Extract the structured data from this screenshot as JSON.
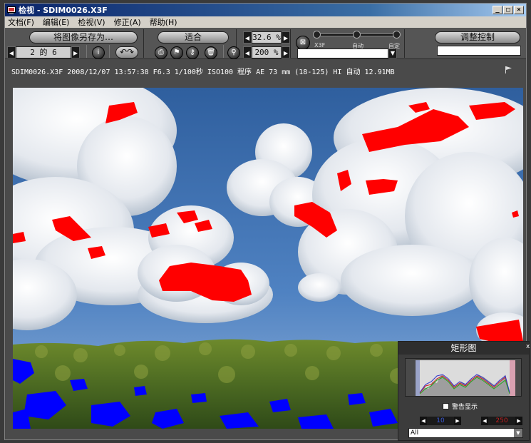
{
  "window": {
    "title": "检视 - SDIM0026.X3F",
    "btn_min": "_",
    "btn_max": "□",
    "btn_close": "×"
  },
  "menu": {
    "items": [
      "文档(F)",
      "编辑(E)",
      "检视(V)",
      "修正(A)",
      "帮助(H)"
    ]
  },
  "toolbar": {
    "save_as_label": "将图像另存为…",
    "fit_label": "适合",
    "zoom_value": "32.6 %",
    "adjust_label": "调整控制",
    "page_indicator": "2 的 6",
    "zoom2_value": "200 %",
    "slider_label_x3f": "X3F",
    "slider_label_auto": "自动",
    "slider_label_custom": "自定",
    "slider_positions_percent": [
      0,
      50,
      100
    ]
  },
  "info": {
    "text": "SDIM0026.X3F 2008/12/07 13:57:38 F6.3 1/100秒 ISO100 程序 AE  73 mm (18-125) HI 自动 12.91MB"
  },
  "histogram": {
    "title": "矩形图",
    "checkbox_label": "警告显示",
    "checked": false,
    "low_value": "10",
    "high_value": "250",
    "channel": "All",
    "close": "x"
  },
  "colors": {
    "highlight_warning": "#ff0000",
    "shadow_warning": "#0000ff",
    "accent": "#0a246a"
  }
}
